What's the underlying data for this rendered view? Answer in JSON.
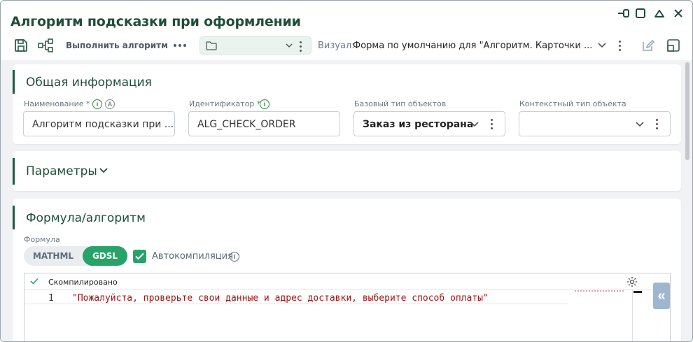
{
  "window": {
    "title": "Алгоритм подсказки при оформлении"
  },
  "toolbar": {
    "run_label": "Выполнить алгоритм",
    "visual_label": "Визуал:",
    "visual_value": "Форма по умолчанию для \"Алгоритм. Карточки ..."
  },
  "general": {
    "title": "Общая информация",
    "name_label": "Наименование *",
    "name_value": "Алгоритм подсказки при ...",
    "id_label": "Идентификатор *",
    "id_value": "ALG_CHECK_ORDER",
    "base_type_label": "Базовый тип объектов",
    "base_type_value": "Заказ из ресторана",
    "context_type_label": "Контекстный тип объекта",
    "context_type_value": ""
  },
  "params": {
    "title": "Параметры"
  },
  "formula": {
    "title": "Формула/алгоритм",
    "formula_label": "Формула",
    "tab_mathml": "MATHML",
    "tab_gdsl": "GDSL",
    "autocompile_label": "Автокомпиляция",
    "status_text": "Скомпилировано",
    "line_number": "1",
    "code_line": "\"Пожалуйста, проверьте свои данные и адрес доставки, выберите способ оплаты\""
  },
  "colors": {
    "accent": "#1f5a40",
    "toggle_active": "#27a36a",
    "code_string": "#a31515"
  }
}
